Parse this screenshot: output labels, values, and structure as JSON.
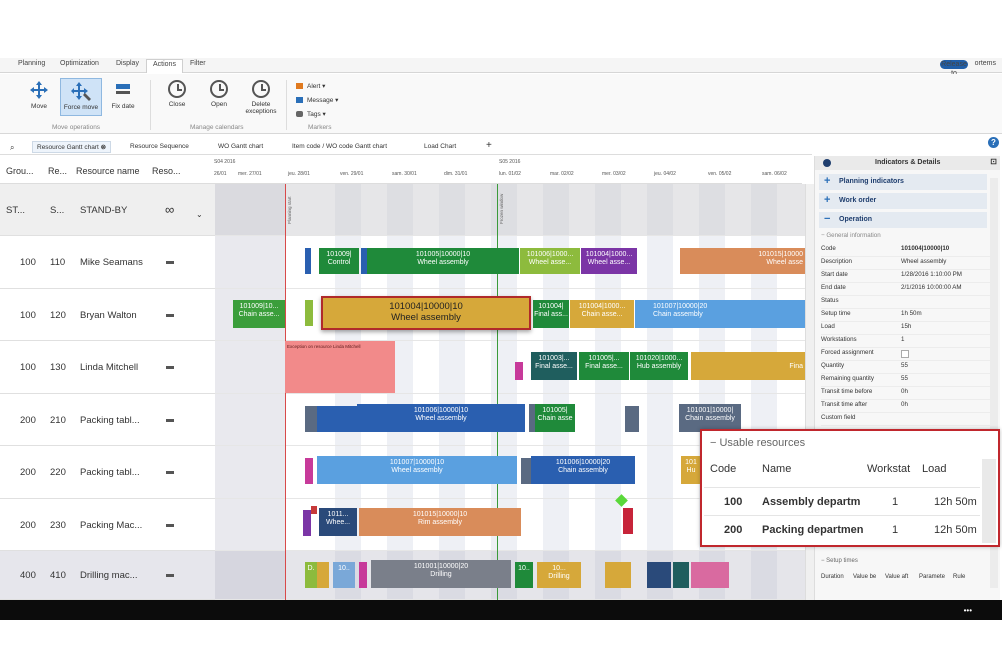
{
  "menu": {
    "tabs": [
      "Planning",
      "Optimization",
      "Display",
      "Actions",
      "Filter"
    ],
    "active_tab": "Actions",
    "brand_badge": "Release to",
    "brand": "ortems"
  },
  "ribbon": {
    "move": "Move",
    "force_move": "Force move",
    "fix_date": "Fix date",
    "group_move": "Move operations",
    "close": "Close",
    "open": "Open",
    "delete_exceptions_1": "Delete",
    "delete_exceptions_2": "exceptions",
    "group_calendars": "Manage calendars",
    "alert": "Alert",
    "message": "Message",
    "tags": "Tags",
    "group_markers": "Markers"
  },
  "tabs": {
    "resource_gantt": "Resource Gantt chart",
    "resource_sequence": "Resource Sequence",
    "wo_gantt": "WO Gantt chart",
    "item_code_gantt": "Item code / WO code Gantt chart",
    "load_chart": "Load Chart",
    "add": "+"
  },
  "grid": {
    "col_group": "Grou...",
    "col_res": "Re...",
    "col_name": "Resource name",
    "col_reso": "Reso...",
    "rows": [
      {
        "group": "ST...",
        "res": "S...",
        "name": "STAND-BY",
        "reso": "∞"
      },
      {
        "group": "100",
        "res": "110",
        "name": "Mike Seamans",
        "reso": ""
      },
      {
        "group": "100",
        "res": "120",
        "name": "Bryan Walton",
        "reso": ""
      },
      {
        "group": "100",
        "res": "130",
        "name": "Linda Mitchell",
        "reso": ""
      },
      {
        "group": "200",
        "res": "210",
        "name": "Packing tabl...",
        "reso": ""
      },
      {
        "group": "200",
        "res": "220",
        "name": "Packing tabl...",
        "reso": ""
      },
      {
        "group": "200",
        "res": "230",
        "name": "Packing Mac...",
        "reso": ""
      },
      {
        "group": "400",
        "res": "410",
        "name": "Drilling mac...",
        "reso": ""
      }
    ]
  },
  "timeline": {
    "weeks": [
      "S04 2016",
      "S05 2016"
    ],
    "days": [
      "26/01",
      "mer. 27/01",
      "jeu. 28/01",
      "ven. 29/01",
      "sam. 30/01",
      "dim. 31/01",
      "lun. 01/02",
      "mar. 02/02",
      "mer. 03/02",
      "jeu. 04/02",
      "ven. 05/02",
      "sam. 06/02"
    ],
    "planning_start": "Planning start",
    "frozen_window": "Frozen window"
  },
  "gantt": {
    "bars": [
      {
        "l1": "101009|",
        "l2": "Control",
        "color": "#1f8a3a"
      },
      {
        "l1": "101005|10000|10",
        "l2": "Wheel assembly",
        "color": "#1f8a3a"
      },
      {
        "l1": "101006|1000...",
        "l2": "Wheel asse...",
        "color": "#8dbb3d"
      },
      {
        "l1": "101004|1000...",
        "l2": "Wheel asse...",
        "color": "#7b35a6"
      },
      {
        "l1": "101015|10000",
        "l2": "Wheel asse",
        "color": "#d98c5a"
      },
      {
        "l1": "101009|10...",
        "l2": "Chain asse...",
        "color": "#3b9e3b"
      },
      {
        "l1": "101004|10000|10",
        "l2": "Wheel assembly",
        "color": "#d6a83a"
      },
      {
        "l1": "101004|",
        "l2": "Final ass...",
        "color": "#1f8a3a"
      },
      {
        "l1": "101004|1000...",
        "l2": "Chain asse...",
        "color": "#d6a83a"
      },
      {
        "l1": "101007|10000|20",
        "l2": "Chain assembly",
        "color": "#5aa0e0"
      },
      {
        "l1": "Exception on resource Linda Mitchell",
        "l2": "",
        "color": "#f28a8a"
      },
      {
        "l1": "101003|...",
        "l2": "Final asse...",
        "color": "#1f5e5e"
      },
      {
        "l1": "101005|...",
        "l2": "Final asse...",
        "color": "#1f8a3a"
      },
      {
        "l1": "101020|1000...",
        "l2": "Hub assembly",
        "color": "#1f8a3a"
      },
      {
        "l1": "",
        "l2": "Fina",
        "color": "#d6a83a"
      },
      {
        "l1": "101006|10000|10",
        "l2": "Wheel assembly",
        "color": "#2a5fb0"
      },
      {
        "l1": "101005|",
        "l2": "Chain asse",
        "color": "#1f8a3a"
      },
      {
        "l1": "101001|10000|",
        "l2": "Chain assembly",
        "color": "#5a6a82"
      },
      {
        "l1": "101007|10000|10",
        "l2": "Wheel assembly",
        "color": "#5aa0e0"
      },
      {
        "l1": "101006|10000|20",
        "l2": "Chain assembly",
        "color": "#2a5fb0"
      },
      {
        "l1": "101",
        "l2": "Hu",
        "color": "#d6a83a"
      },
      {
        "l1": "1011...",
        "l2": "Whee...",
        "color": "#2a4a7a"
      },
      {
        "l1": "101015|10000|10",
        "l2": "Rim assembly",
        "color": "#d98c5a"
      },
      {
        "l1": "101001|10000|20",
        "l2": "Drilling",
        "color": "#7a7f8a"
      },
      {
        "l1": "10...",
        "l2": "Drilling",
        "color": "#8f8f98"
      }
    ]
  },
  "panel": {
    "title": "Indicators & Details",
    "planning_indicators": "Planning indicators",
    "work_order": "Work order",
    "operation": "Operation",
    "general_information": "General information",
    "fields": [
      {
        "k": "Code",
        "v": "101004|10000|10"
      },
      {
        "k": "Description",
        "v": "Wheel assembly"
      },
      {
        "k": "Start date",
        "v": "1/28/2016 1:10:00 PM"
      },
      {
        "k": "End date",
        "v": "2/1/2016 10:00:00 AM"
      },
      {
        "k": "Status",
        "v": ""
      },
      {
        "k": "Setup time",
        "v": "1h 50m"
      },
      {
        "k": "Load",
        "v": "15h"
      },
      {
        "k": "Workstations",
        "v": "1"
      },
      {
        "k": "Forced assignment",
        "v": ""
      },
      {
        "k": "Quantity",
        "v": "55"
      },
      {
        "k": "Remaining quantity",
        "v": "55"
      },
      {
        "k": "Transit time before",
        "v": "0h"
      },
      {
        "k": "Transit time after",
        "v": "0h"
      },
      {
        "k": "Custom field",
        "v": ""
      }
    ],
    "setup_times": "Setup times",
    "setup_cols": [
      "Duration",
      "Value be",
      "Value aft",
      "Paramete",
      "Rule"
    ]
  },
  "usable_resources": {
    "title": "Usable resources",
    "cols": [
      "Code",
      "Name",
      "Workstat",
      "Load"
    ],
    "rows": [
      {
        "code": "100",
        "name": "Assembly departm",
        "ws": "1",
        "load": "12h 50m"
      },
      {
        "code": "200",
        "name": "Packing departmen",
        "ws": "1",
        "load": "12h 50m"
      }
    ]
  },
  "colors": {
    "accent": "#2a6fb8",
    "popup_border": "#c0272d",
    "selected_bar_border": "#b02a2a",
    "planning_line": "#d84a4a",
    "frozen_line": "#3a9a3a"
  }
}
